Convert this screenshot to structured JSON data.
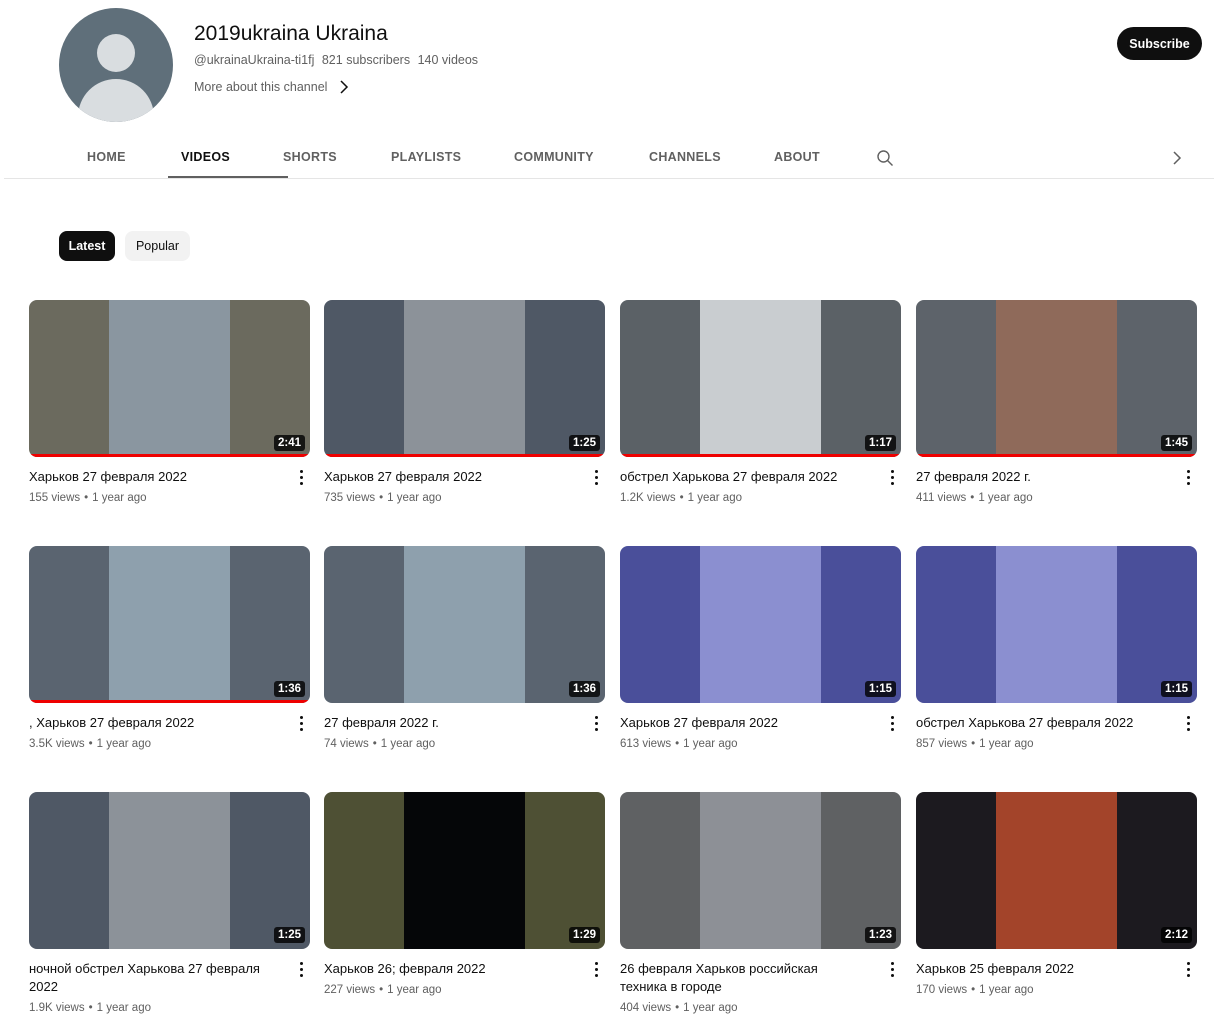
{
  "channel": {
    "name": "2019ukraina Ukraina",
    "handle": "@ukrainaUkraina-ti1fj",
    "subscribers": "821 subscribers",
    "videos_count": "140 videos",
    "more_about": "More about this channel",
    "subscribe_label": "Subscribe"
  },
  "tabs": [
    {
      "label": "HOME",
      "active": false
    },
    {
      "label": "VIDEOS",
      "active": true
    },
    {
      "label": "SHORTS",
      "active": false
    },
    {
      "label": "PLAYLISTS",
      "active": false
    },
    {
      "label": "COMMUNITY",
      "active": false
    },
    {
      "label": "CHANNELS",
      "active": false
    },
    {
      "label": "ABOUT",
      "active": false
    }
  ],
  "chips": [
    {
      "label": "Latest",
      "selected": true
    },
    {
      "label": "Popular",
      "selected": false
    }
  ],
  "videos": [
    {
      "title": "Харьков 27 февраля 2022",
      "views": "155 views",
      "age": "1 year ago",
      "duration": "2:41",
      "watched": true,
      "colors": [
        "#6b6a5e",
        "#8a96a0",
        "#6b6a5e"
      ]
    },
    {
      "title": "Харьков 27 февраля 2022",
      "views": "735 views",
      "age": "1 year ago",
      "duration": "1:25",
      "watched": true,
      "colors": [
        "#4f5865",
        "#8c9299",
        "#4f5865"
      ]
    },
    {
      "title": "обстрел Харькова 27 февраля 2022",
      "views": "1.2K views",
      "age": "1 year ago",
      "duration": "1:17",
      "watched": true,
      "colors": [
        "#5b6166",
        "#c9cdd0",
        "#5b6166"
      ]
    },
    {
      "title": "27 февраля 2022 г.",
      "views": "411 views",
      "age": "1 year ago",
      "duration": "1:45",
      "watched": true,
      "colors": [
        "#5d636a",
        "#8f6a5a",
        "#5d636a"
      ]
    },
    {
      "title": ", Харьков 27 февраля 2022",
      "views": "3.5K views",
      "age": "1 year ago",
      "duration": "1:36",
      "watched": true,
      "colors": [
        "#5a6470",
        "#8ea0ad",
        "#5a6470"
      ]
    },
    {
      "title": "27 февраля 2022 г.",
      "views": "74 views",
      "age": "1 year ago",
      "duration": "1:36",
      "watched": false,
      "colors": [
        "#5a6470",
        "#8ea0ad",
        "#5a6470"
      ]
    },
    {
      "title": "Харьков 27 февраля 2022",
      "views": "613 views",
      "age": "1 year ago",
      "duration": "1:15",
      "watched": false,
      "colors": [
        "#4a4f9a",
        "#8b8fd0",
        "#4a4f9a"
      ]
    },
    {
      "title": "обстрел Харькова 27 февраля 2022",
      "views": "857 views",
      "age": "1 year ago",
      "duration": "1:15",
      "watched": false,
      "colors": [
        "#4a4f9a",
        "#8b8fd0",
        "#4a4f9a"
      ]
    },
    {
      "title": "ночной обстрел Харькова 27 февраля 2022",
      "views": "1.9K views",
      "age": "1 year ago",
      "duration": "1:25",
      "watched": false,
      "colors": [
        "#4f5865",
        "#8c9299",
        "#4f5865"
      ]
    },
    {
      "title": "Харьков 26; февраля 2022",
      "views": "227 views",
      "age": "1 year ago",
      "duration": "1:29",
      "watched": false,
      "colors": [
        "#4e5034",
        "#050608",
        "#4e5034"
      ]
    },
    {
      "title": "26 февраля Харьков российская техника в городе",
      "views": "404 views",
      "age": "1 year ago",
      "duration": "1:23",
      "watched": false,
      "colors": [
        "#5f6163",
        "#8d9096",
        "#5f6163"
      ]
    },
    {
      "title": "Харьков 25 февраля 2022",
      "views": "170 views",
      "age": "1 year ago",
      "duration": "2:12",
      "watched": false,
      "colors": [
        "#1c1a1f",
        "#a3442a",
        "#1c1a1f"
      ]
    }
  ],
  "meta_separator": "•"
}
